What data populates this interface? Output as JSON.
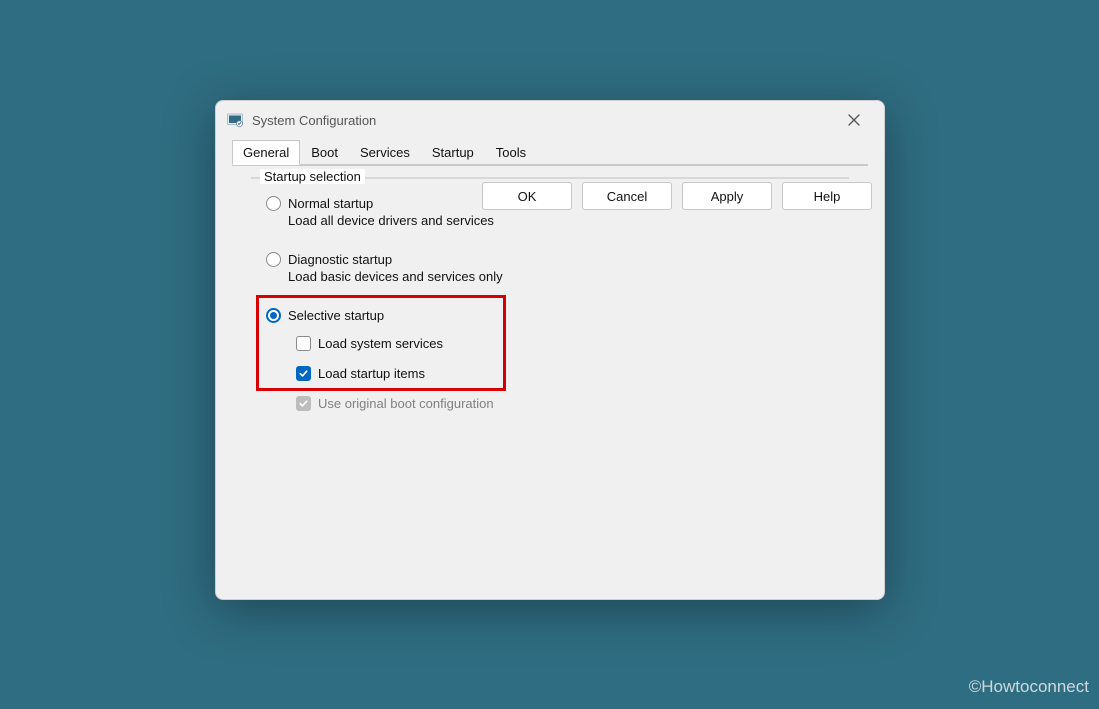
{
  "window": {
    "title": "System Configuration"
  },
  "tabs": {
    "general": "General",
    "boot": "Boot",
    "services": "Services",
    "startup": "Startup",
    "tools": "Tools"
  },
  "group": {
    "title": "Startup selection",
    "normal": {
      "label": "Normal startup",
      "desc": "Load all device drivers and services"
    },
    "diagnostic": {
      "label": "Diagnostic startup",
      "desc": "Load basic devices and services only"
    },
    "selective": {
      "label": "Selective startup",
      "load_system_services": "Load system services",
      "load_startup_items": "Load startup items",
      "use_original_boot": "Use original boot configuration"
    }
  },
  "buttons": {
    "ok": "OK",
    "cancel": "Cancel",
    "apply": "Apply",
    "help": "Help"
  },
  "watermark": "©Howtoconnect"
}
